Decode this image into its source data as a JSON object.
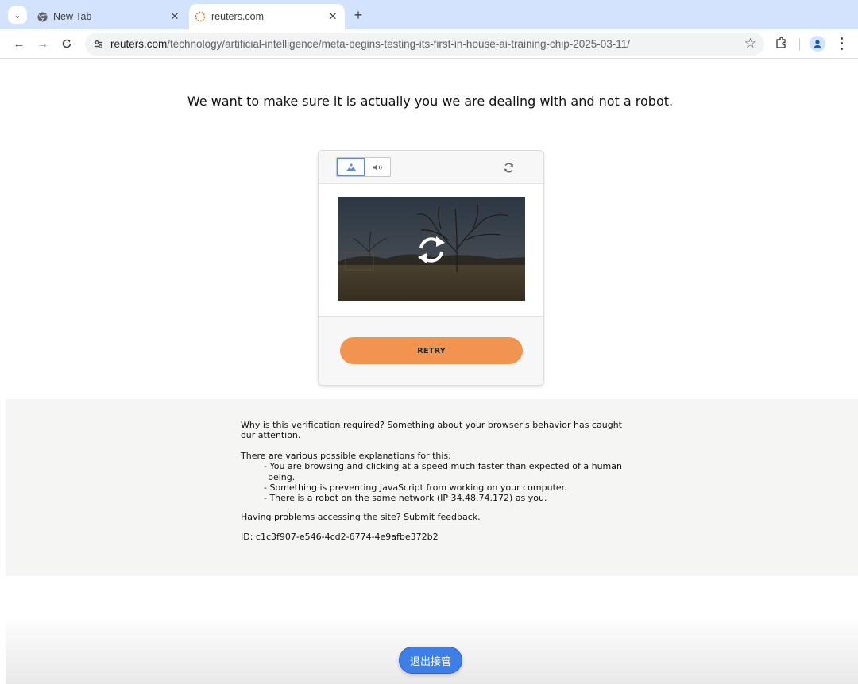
{
  "browser": {
    "tabs": [
      {
        "title": "New Tab",
        "active": false,
        "icon": "chrome-icon"
      },
      {
        "title": "reuters.com",
        "active": true,
        "icon": "loading-spinner-icon"
      }
    ],
    "url_host": "reuters.com",
    "url_path": "/technology/artificial-intelligence/meta-begins-testing-its-first-in-house-ai-training-chip-2025-03-11/"
  },
  "page": {
    "heading": "We want to make sure it is actually you we are dealing with and not a robot.",
    "captcha": {
      "retry_label": "RETRY"
    },
    "info": {
      "why": "Why is this verification required? Something about your browser's behavior has caught our attention.",
      "explanations_intro": "There are various possible explanations for this:",
      "explanations": [
        "- You are browsing and clicking at a speed much faster than expected of a human being.",
        "- Something is preventing JavaScript from working on your computer.",
        "- There is a robot on the same network (IP 34.48.74.172) as you."
      ],
      "problems_text": "Having problems accessing the site?",
      "feedback_link": "Submit feedback.",
      "id_text": "ID: c1c3f907-e546-4cd2-6774-4e9afbe372b2"
    },
    "takeover_label": "退出接管"
  },
  "colors": {
    "tabstrip": "#d3e3fd",
    "retry_button": "#f0944f",
    "takeover_button": "#3d7ee8",
    "captcha_mode_selected": "#5b8bd6"
  }
}
